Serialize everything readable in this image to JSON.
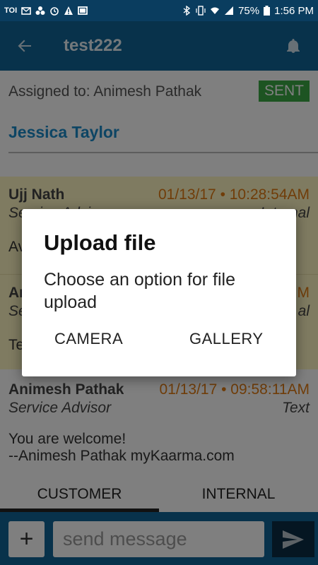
{
  "status_bar": {
    "left_text": "TOI",
    "battery": "75%",
    "time": "1:56 PM"
  },
  "app_bar": {
    "title": "test222"
  },
  "assignment": {
    "assigned_to": "Assigned to: Animesh Pathak",
    "status_badge": "SENT",
    "customer_name": "Jessica Taylor"
  },
  "messages": [
    {
      "sender": "Ujj Nath",
      "timestamp": "01/13/17 • 10:28:54AM",
      "role": "Service Advisor",
      "type": "Internal",
      "body": "Av"
    },
    {
      "sender": "An",
      "timestamp": "M",
      "role": "Se",
      "type": "al",
      "body": "Te"
    },
    {
      "sender": "Animesh Pathak",
      "timestamp": "01/13/17 • 09:58:11AM",
      "role": "Service Advisor",
      "type": "Text",
      "body_line1": "You are welcome!",
      "body_line2": "--Animesh Pathak myKaarma.com"
    }
  ],
  "tabs": [
    {
      "label": "CUSTOMER",
      "active": true
    },
    {
      "label": "INTERNAL",
      "active": false
    }
  ],
  "composer": {
    "plus_label": "+",
    "placeholder": "send message"
  },
  "dialog": {
    "title": "Upload file",
    "message": "Choose an option for file upload",
    "camera_label": "CAMERA",
    "gallery_label": "GALLERY"
  },
  "colors": {
    "status_bar": "#0a3d5f",
    "app_bar": "#106596",
    "accent_blue": "#1a8ac9",
    "sent_green": "#3aa845",
    "timestamp_orange": "#e07b13",
    "internal_bg": "#fff7c2"
  },
  "icons": {
    "back": "arrow-left-icon",
    "bell": "bell-icon",
    "send": "send-icon"
  }
}
